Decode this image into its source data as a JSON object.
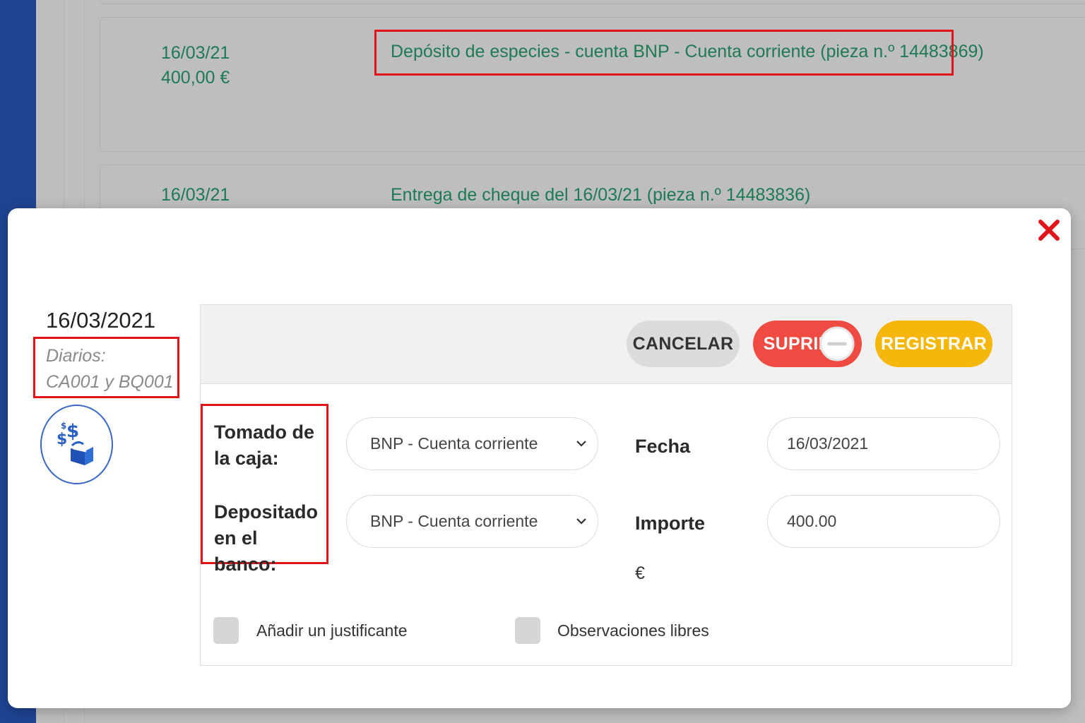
{
  "background": {
    "entries": [
      {
        "date": "16/03/21",
        "amount": "400,00 €",
        "description": "Depósito de especies - cuenta BNP - Cuenta corriente (pieza n.º 14483869)"
      },
      {
        "date": "16/03/21",
        "description": "Entrega de cheque del 16/03/21 (pieza n.º 14483836)"
      }
    ]
  },
  "modal": {
    "date": "16/03/2021",
    "journals_line1": "Diarios:",
    "journals_line2": "CA001 y BQ001",
    "operation_icon": "cash-deposit-icon",
    "buttons": {
      "cancel": "CANCELAR",
      "delete": "SUPRIMIR",
      "save": "REGISTRAR"
    },
    "form": {
      "taken_from_label": "Tomado de la caja:",
      "taken_from_value": "BNP - Cuenta corriente",
      "deposited_label": "Depositado en el banco:",
      "deposited_value": "BNP - Cuenta corriente",
      "date_label": "Fecha",
      "date_value": "16/03/2021",
      "amount_label": "Importe",
      "amount_value": "400.00",
      "currency": "€"
    },
    "options": {
      "attach_receipt": "Añadir un justificante",
      "free_notes": "Observaciones libres"
    }
  },
  "colors": {
    "accent_green": "#1d7a55",
    "delete_red": "#ef4b43",
    "save_yellow": "#f5b70b",
    "highlight_red": "#e0151a",
    "rail_blue": "#1f4493"
  }
}
